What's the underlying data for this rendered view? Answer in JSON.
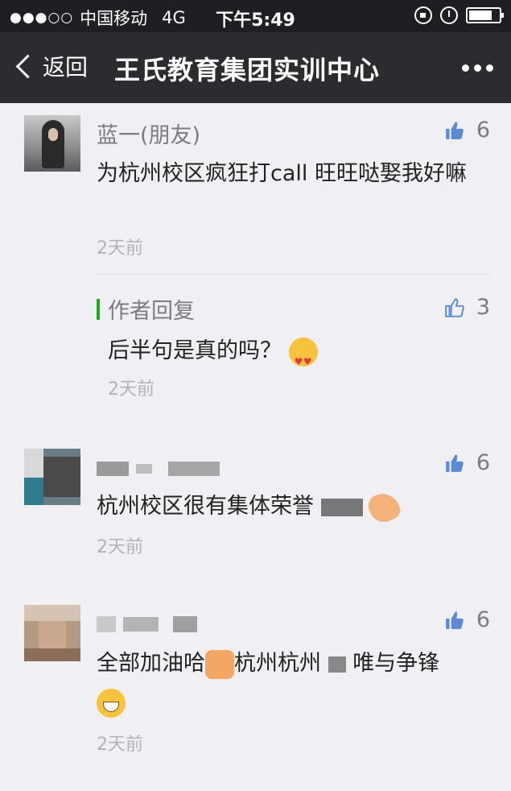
{
  "status_bar": {
    "signal_dots": "●●●○○",
    "carrier": "中国移动",
    "network": "4G",
    "time": "下午5:49"
  },
  "nav": {
    "back_label": "返回",
    "title": "王氏教育集团实训中心"
  },
  "comments": [
    {
      "name": "蓝一(朋友)",
      "text": "为杭州校区疯狂打call 旺旺哒娶我好嘛",
      "time": "2天前",
      "likes": "6",
      "reply": {
        "label": "作者回复",
        "text": "后半句是真的吗？",
        "time": "2天前",
        "likes": "3"
      }
    },
    {
      "name": "",
      "text": "杭州校区很有集体荣誉",
      "time": "2天前",
      "likes": "6"
    },
    {
      "name": "",
      "text_a": "全部加油哈",
      "text_b": "杭州杭州",
      "text_c": "唯与争锋",
      "time": "2天前",
      "likes": "6"
    }
  ],
  "icons": {
    "thumb": "thumbs-up-icon",
    "back": "chevron-left-icon",
    "more": "more-dots-icon"
  },
  "colors": {
    "nav_bg": "#2c2c30",
    "reply_accent": "#1aad19",
    "like_icon": "#5b8ad6"
  }
}
